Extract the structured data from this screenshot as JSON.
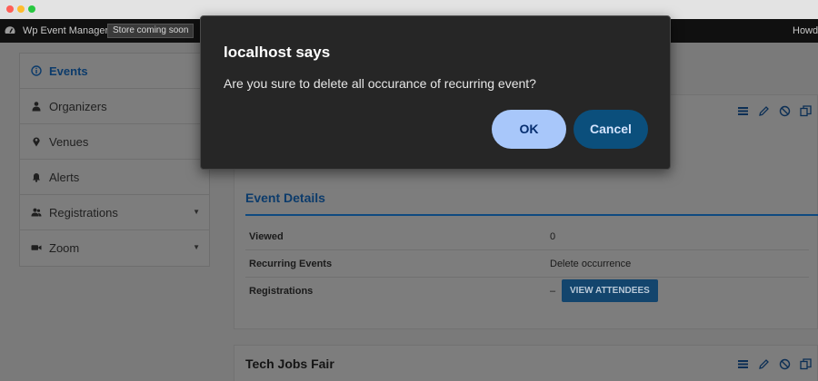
{
  "admin_bar": {
    "site_name": "Wp Event Manager",
    "badge": "Store coming soon",
    "howdy": "Howdy"
  },
  "sidebar": {
    "items": [
      {
        "label": "Events",
        "icon": "info-circle-icon",
        "active": true
      },
      {
        "label": "Organizers",
        "icon": "person-icon"
      },
      {
        "label": "Venues",
        "icon": "location-pin-icon"
      },
      {
        "label": "Alerts",
        "icon": "bell-icon"
      },
      {
        "label": "Registrations",
        "icon": "users-icon",
        "caret": "▼"
      },
      {
        "label": "Zoom",
        "icon": "video-camera-icon",
        "caret": "▼"
      }
    ]
  },
  "event_details": {
    "title": "Event Details",
    "rows": [
      {
        "key": "Viewed",
        "value": "0"
      },
      {
        "key": "Recurring Events",
        "value": "Delete occurrence"
      },
      {
        "key": "Registrations",
        "value": "–",
        "button": "VIEW ATTENDEES"
      }
    ]
  },
  "second_card": {
    "title": "Tech Jobs Fair"
  },
  "dialog": {
    "title": "localhost says",
    "message": "Are you sure to delete all occurance of recurring event?",
    "ok_label": "OK",
    "cancel_label": "Cancel"
  },
  "colors": {
    "accent": "#0f4a80",
    "ok_button": "#a8c7fa",
    "cancel_button": "#0b4f7c",
    "dialog_bg": "#262626"
  }
}
